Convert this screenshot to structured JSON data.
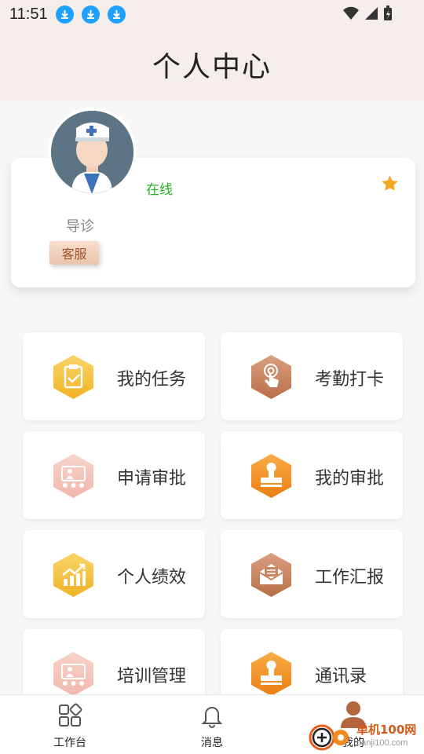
{
  "status": {
    "time": "11:51"
  },
  "header": {
    "title": "个人中心"
  },
  "profile": {
    "status": "在线",
    "role": "导诊",
    "tag": "客服"
  },
  "menu": [
    {
      "label": "我的任务"
    },
    {
      "label": "考勤打卡"
    },
    {
      "label": "申请审批"
    },
    {
      "label": "我的审批"
    },
    {
      "label": "个人绩效"
    },
    {
      "label": "工作汇报"
    },
    {
      "label": "培训管理"
    },
    {
      "label": "通讯录"
    }
  ],
  "tabs": [
    {
      "label": "工作台"
    },
    {
      "label": "消息"
    },
    {
      "label": "我的"
    }
  ],
  "watermark": {
    "brand": "单机100网",
    "url": "danji100.com"
  },
  "colors": {
    "header_bg": "#f5ede9",
    "online": "#22b522",
    "star": "#f5a623",
    "yellow": "#f4bd2c",
    "brown": "#c98560",
    "orange": "#f08f1e",
    "pink": "#f5c5bd"
  }
}
